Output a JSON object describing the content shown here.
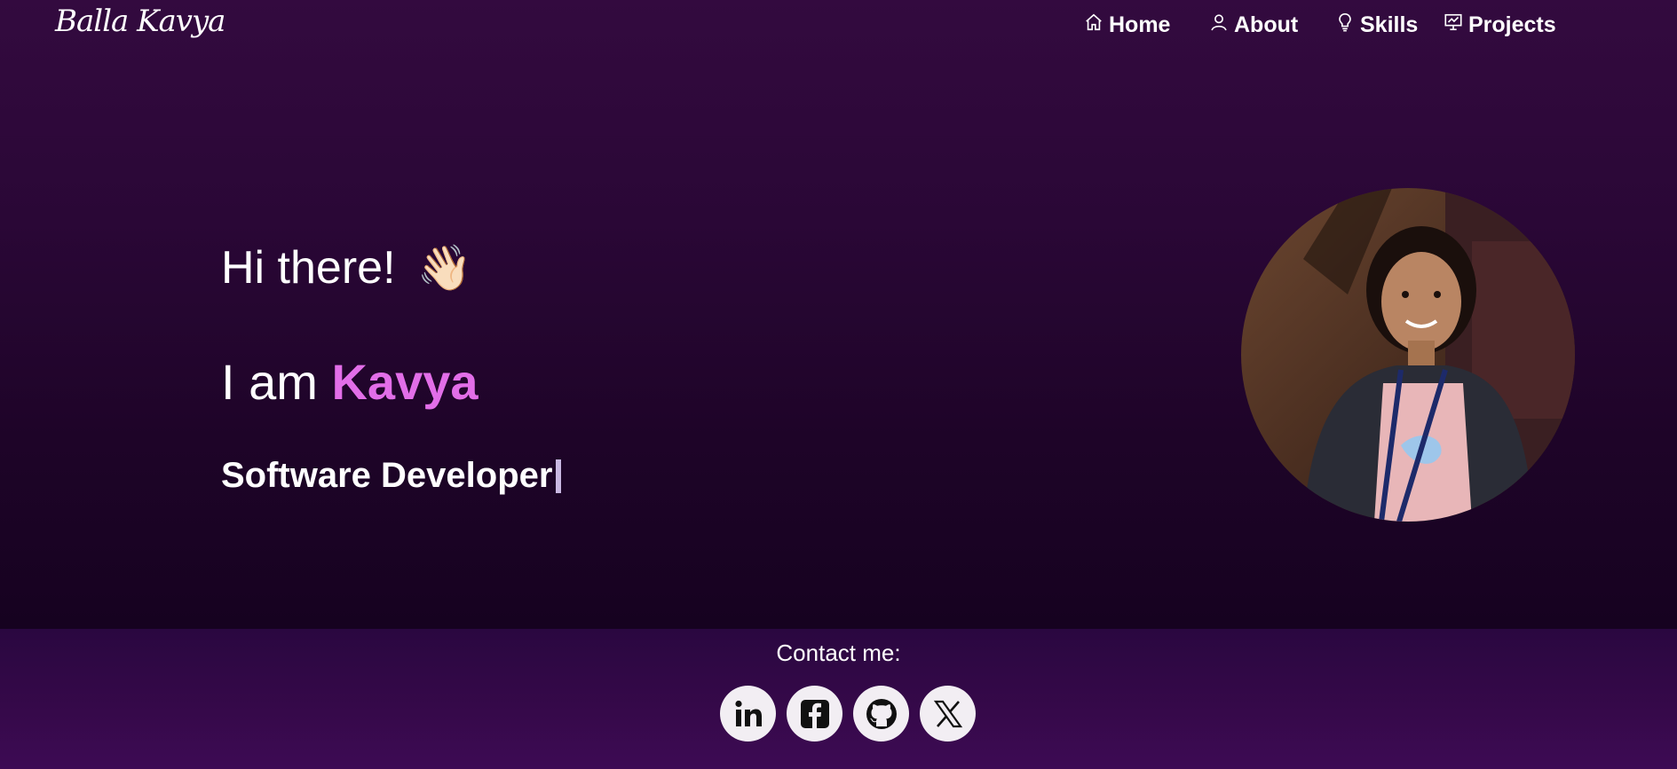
{
  "brand": {
    "logo_text": "Balla Kavya"
  },
  "nav": {
    "items": [
      {
        "label": "Home",
        "icon": "home-icon"
      },
      {
        "label": "About",
        "icon": "user-icon"
      },
      {
        "label": "Skills",
        "icon": "lightbulb-icon"
      },
      {
        "label": "Projects",
        "icon": "presentation-icon"
      }
    ]
  },
  "hero": {
    "greeting": "Hi there!",
    "wave_emoji": "👋🏻",
    "intro_prefix": "I am",
    "name": "Kavya",
    "role": "Software Developer"
  },
  "footer": {
    "contact_label": "Contact me:",
    "socials": [
      {
        "icon": "linkedin-icon"
      },
      {
        "icon": "facebook-icon"
      },
      {
        "icon": "github-icon"
      },
      {
        "icon": "x-icon"
      }
    ]
  },
  "colors": {
    "accent": "#e26ee8",
    "hero_bg_top": "#330a3f",
    "hero_bg_bottom": "#160220",
    "footer_bg": "#36094a"
  }
}
